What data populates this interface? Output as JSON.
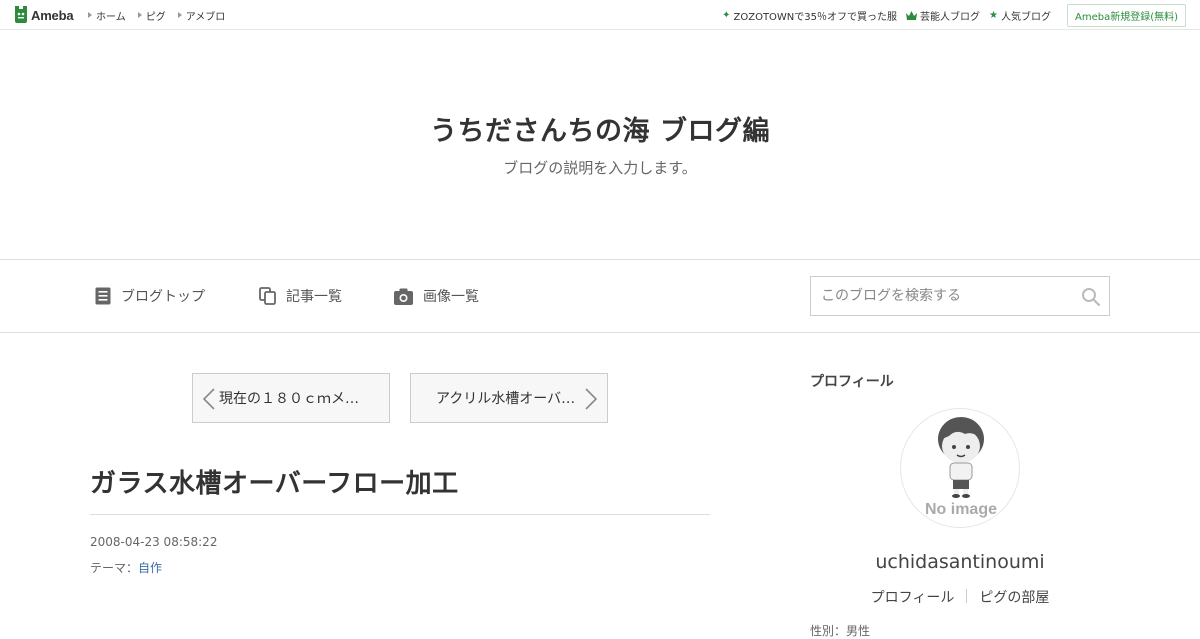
{
  "topbar": {
    "logo_text": "Ameba",
    "nav": [
      "ホーム",
      "ピグ",
      "アメブロ"
    ],
    "links": [
      {
        "icon": "sparkle-icon",
        "label": "ZOZOTOWNで35％オフで買った服"
      },
      {
        "icon": "crown-icon",
        "label": "芸能人ブログ"
      },
      {
        "icon": "star-icon",
        "label": "人気ブログ"
      }
    ],
    "register_label": "Ameba新規登録(無料)"
  },
  "header": {
    "title": "うちださんちの海 ブログ編",
    "description": "ブログの説明を入力します。"
  },
  "nav": {
    "blog_top": "ブログトップ",
    "entry_list": "記事一覧",
    "image_list": "画像一覧",
    "search_placeholder": "このブログを検索する"
  },
  "pager": {
    "prev_title": "現在の１８０ｃｍメ…",
    "next_title": "アクリル水槽オーバ…"
  },
  "article": {
    "title": "ガラス水槽オーバーフロー加工",
    "date": "2008-04-23 08:58:22",
    "theme_label": "テーマ：",
    "theme_value": "自作"
  },
  "sidebar": {
    "heading": "プロフィール",
    "avatar_text": "No image",
    "username": "uchidasantinoumi",
    "links": [
      "プロフィール",
      "ピグの部屋"
    ],
    "cut_text": "性別：男性"
  },
  "colors": {
    "accent_green": "#2d8c3c",
    "link_blue": "#3a6ea5"
  }
}
